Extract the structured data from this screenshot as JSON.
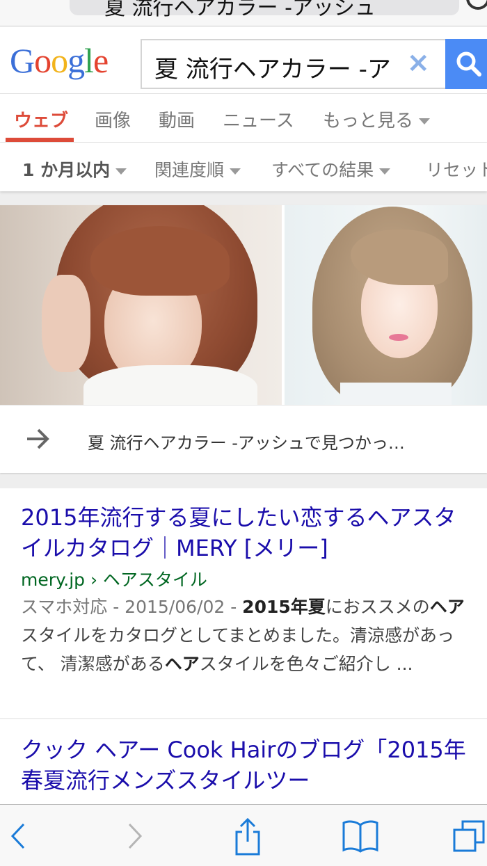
{
  "browser": {
    "url_text": "夏 流行ヘアカラー -アッシュ"
  },
  "google": {
    "logo_letters": [
      "G",
      "o",
      "o",
      "g",
      "l",
      "e"
    ],
    "logo_colors": [
      "#3b6fd8",
      "#e4432f",
      "#f2b31b",
      "#3b6fd8",
      "#31a251",
      "#e4432f"
    ],
    "search_query": "夏 流行ヘアカラー  -ア",
    "clear_symbol": "×"
  },
  "tabs": [
    {
      "label": "ウェブ",
      "active": true
    },
    {
      "label": "画像",
      "active": false
    },
    {
      "label": "動画",
      "active": false
    },
    {
      "label": "ニュース",
      "active": false
    },
    {
      "label": "もっと見る",
      "active": false
    }
  ],
  "filters": [
    {
      "label": "1 か月以内"
    },
    {
      "label": "関連度順"
    },
    {
      "label": "すべての結果"
    },
    {
      "label": "リセット"
    }
  ],
  "image_card": {
    "more_text": "夏 流行ヘアカラー -アッシュで見つかっ…"
  },
  "results": [
    {
      "title": "2015年流行する夏にしたい恋するヘアスタイルカタログ｜MERY [メリー]",
      "url": "mery.jp › ヘアスタイル",
      "meta": "スマホ対応 - 2015/06/02 - ",
      "snippet_parts": [
        "2015年",
        "夏",
        "におススメの",
        "ヘア",
        "スタイルをカタログとしてまとめました。清涼感があって、 清潔感がある",
        "ヘア",
        "スタイルを色々ご紹介し ..."
      ]
    },
    {
      "title": "クック ヘアー Cook Hairのブログ「2015年春夏流行メンズスタイルツー"
    }
  ],
  "toolbar": {
    "icons": [
      "back-icon",
      "forward-icon",
      "share-icon",
      "bookmarks-icon",
      "tabs-icon"
    ]
  },
  "colors": {
    "link": "#1a0dab",
    "url_green": "#006621",
    "active_tab": "#dd4b39",
    "search_button": "#4b8bf5",
    "toolbar_blue": "#1a7bd8"
  }
}
